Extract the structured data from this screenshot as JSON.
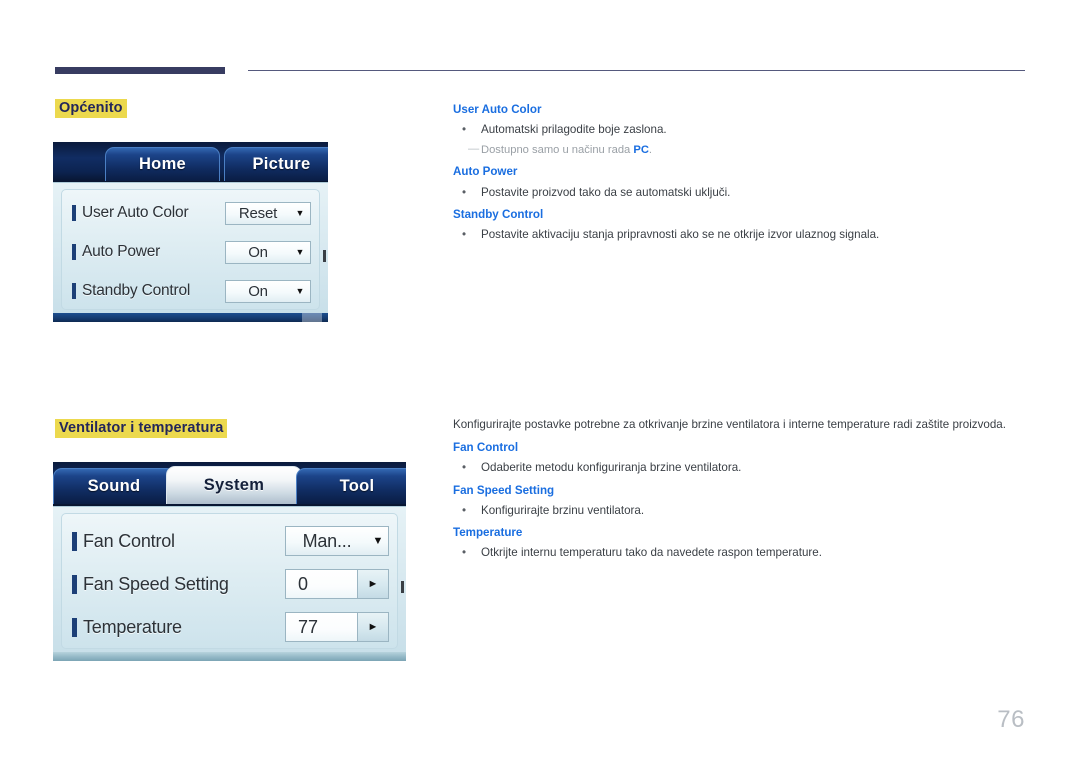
{
  "page": {
    "number": "76"
  },
  "sections": [
    {
      "heading": "Općenito",
      "osd": {
        "tabs": [
          {
            "label": "Home",
            "active": false
          },
          {
            "label": "Picture",
            "active": false
          }
        ],
        "rows": [
          {
            "label": "User Auto Color",
            "value": "Reset",
            "control": "dropdown"
          },
          {
            "label": "Auto Power",
            "value": "On",
            "control": "dropdown"
          },
          {
            "label": "Standby Control",
            "value": "On",
            "control": "dropdown"
          }
        ]
      },
      "description": {
        "intro": "",
        "items": [
          {
            "heading": "User Auto Color",
            "bullet": "Automatski prilagodite boje zaslona.",
            "note_prefix": "Dostupno samo u načinu rada ",
            "note_accent": "PC",
            "note_suffix": "."
          },
          {
            "heading": "Auto Power",
            "bullet": "Postavite proizvod tako da se automatski uključi."
          },
          {
            "heading": "Standby Control",
            "bullet": "Postavite aktivaciju stanja pripravnosti ako se ne otkrije izvor ulaznog signala."
          }
        ]
      }
    },
    {
      "heading": "Ventilator i temperatura",
      "osd": {
        "tabs": [
          {
            "label": "Sound",
            "active": false
          },
          {
            "label": "System",
            "active": true
          },
          {
            "label": "Tool",
            "active": false
          }
        ],
        "rows": [
          {
            "label": "Fan Control",
            "value": "Man...",
            "control": "dropdown"
          },
          {
            "label": "Fan Speed Setting",
            "value": "0",
            "control": "stepper"
          },
          {
            "label": "Temperature",
            "value": "77",
            "control": "stepper"
          }
        ]
      },
      "description": {
        "intro": "Konfigurirajte postavke potrebne za otkrivanje brzine ventilatora i interne temperature radi zaštite proizvoda.",
        "items": [
          {
            "heading": "Fan Control",
            "bullet": "Odaberite metodu konfiguriranja brzine ventilatora."
          },
          {
            "heading": "Fan Speed Setting",
            "bullet": "Konfigurirajte brzinu ventilatora."
          },
          {
            "heading": "Temperature",
            "bullet": "Otkrijte internu temperaturu tako da navedete raspon temperature."
          }
        ]
      }
    }
  ],
  "icons": {
    "caret_down": "▼",
    "caret_right": "►",
    "bullet": "•",
    "note_dash": "—"
  },
  "colors": {
    "heading_highlight": "#ecd94e",
    "heading_text": "#23265a",
    "accent_blue": "#1a6ee0",
    "rule_dark": "#383c61",
    "page_number": "#b9bec4"
  }
}
